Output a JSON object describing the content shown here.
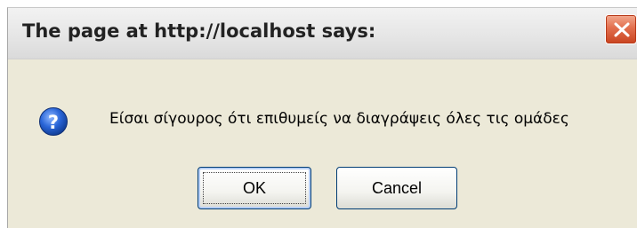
{
  "dialog": {
    "title": "The page at http://localhost says:",
    "message": "Είσαι σίγουρος ότι επιθυμείς να διαγράψεις όλες τις ομάδες",
    "icon": "question-icon",
    "buttons": {
      "ok_label": "OK",
      "cancel_label": "Cancel"
    },
    "focused_button": "OK",
    "colors": {
      "dialog_background": "#ece9d8",
      "close_button": "#e26f4e",
      "icon_blue": "#1f5fd1",
      "button_border": "#003c74"
    }
  }
}
